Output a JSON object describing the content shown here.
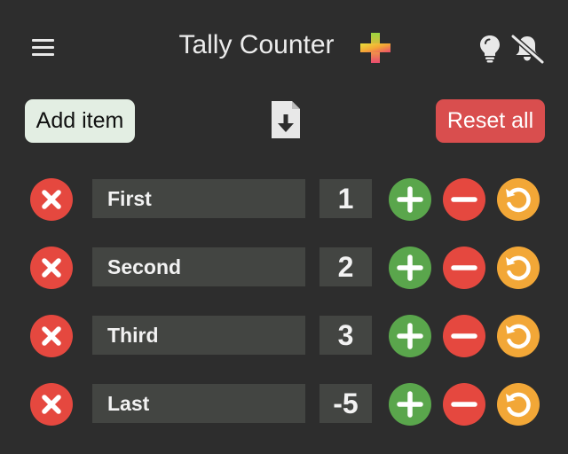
{
  "header": {
    "title": "Tally Counter",
    "menu_icon": "hamburger-menu-icon",
    "logo_icon": "gradient-plus-icon",
    "hint_icon": "lightbulb-icon",
    "sound_icon": "bell-slash-icon"
  },
  "toolbar": {
    "add_item_label": "Add item",
    "export_icon": "file-download-icon",
    "reset_all_label": "Reset all"
  },
  "counters": [
    {
      "name": "First",
      "count": "1"
    },
    {
      "name": "Second",
      "count": "2"
    },
    {
      "name": "Third",
      "count": "3"
    },
    {
      "name": "Last",
      "count": "-5"
    }
  ],
  "colors": {
    "background": "#2d2d2d",
    "field": "#434542",
    "delete": "#e5483f",
    "increment": "#5aa64c",
    "decrement": "#e5483f",
    "reset": "#f2a737",
    "add_button": "#e3eee3",
    "reset_all_button": "#d94e4e"
  }
}
